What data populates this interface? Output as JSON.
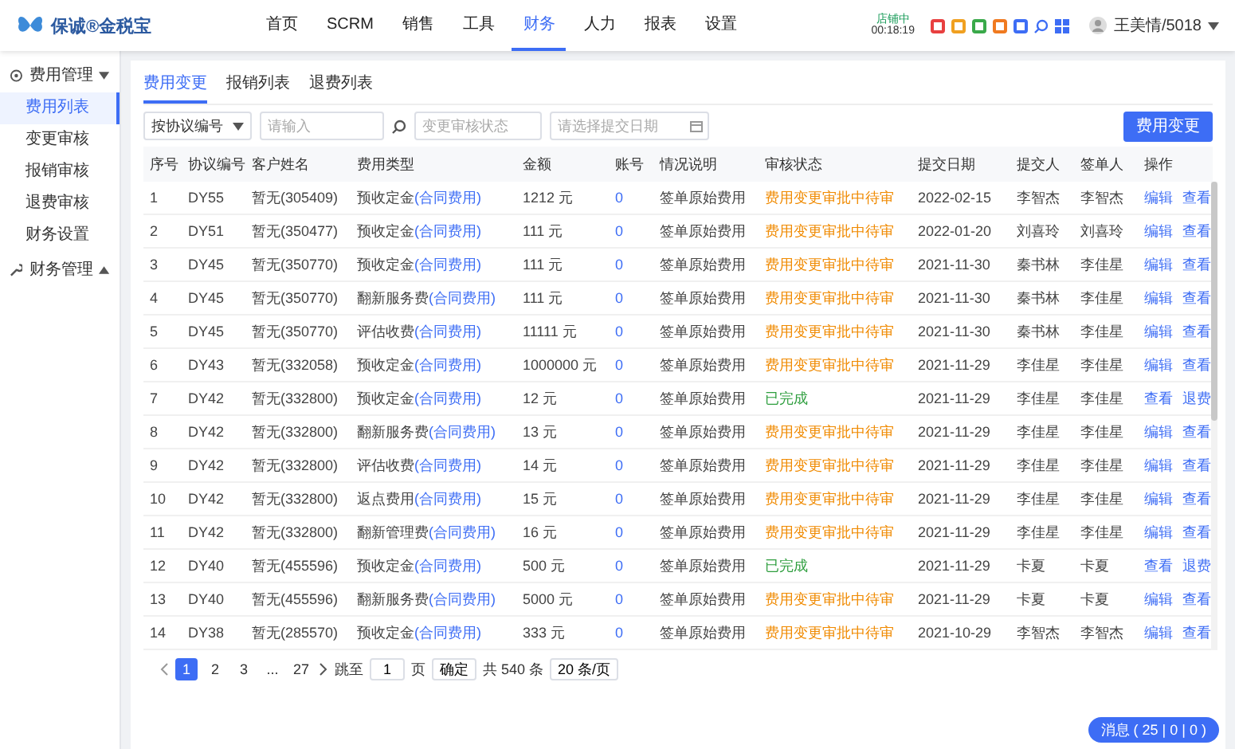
{
  "header": {
    "logo": "保诚®金税宝",
    "nav": [
      {
        "label": "首页",
        "selected": false
      },
      {
        "label": "SCRM",
        "selected": false
      },
      {
        "label": "销售",
        "selected": false
      },
      {
        "label": "工具",
        "selected": false
      },
      {
        "label": "财务",
        "selected": true
      },
      {
        "label": "人力",
        "selected": false
      },
      {
        "label": "报表",
        "selected": false
      },
      {
        "label": "设置",
        "selected": false
      }
    ],
    "status": "店铺中",
    "time": "00:18:19",
    "user": "王美情/5018"
  },
  "sidebar": [
    {
      "label": "费用管理",
      "expanded": true,
      "children": [
        {
          "label": "费用列表",
          "selected": true
        },
        {
          "label": "变更审核",
          "selected": false
        },
        {
          "label": "报销审核",
          "selected": false
        },
        {
          "label": "退费审核",
          "selected": false
        },
        {
          "label": "财务设置",
          "selected": false
        }
      ]
    },
    {
      "label": "财务管理",
      "expanded": false
    }
  ],
  "tabs": [
    {
      "label": "费用变更",
      "selected": true
    },
    {
      "label": "报销列表",
      "selected": false
    },
    {
      "label": "退费列表",
      "selected": false
    }
  ],
  "filters": {
    "search_by": "按协议编号",
    "search_placeholder": "请输入",
    "status_placeholder": "变更审核状态",
    "date_placeholder": "请选择提交日期"
  },
  "action_button": "费用变更",
  "table": {
    "columns": [
      "序号",
      "协议编号",
      "客户姓名",
      "费用类型",
      "金额",
      "账号",
      "情况说明",
      "审核状态",
      "提交日期",
      "提交人",
      "签单人",
      "操作"
    ],
    "rows": [
      {
        "no": "1",
        "code": "DY55",
        "customer": "暂无(305409)",
        "fee": "预收定金",
        "fee_link": "(合同费用)",
        "amount": "1212 元",
        "account": "0",
        "note": "签单原始费用",
        "status": "费用变更审批中待审",
        "kind": "pending",
        "date": "2022-02-15",
        "submitter": "李智杰",
        "signer": "李智杰",
        "actions": [
          "编辑",
          "查看"
        ]
      },
      {
        "no": "2",
        "code": "DY51",
        "customer": "暂无(350477)",
        "fee": "预收定金",
        "fee_link": "(合同费用)",
        "amount": "111 元",
        "account": "0",
        "note": "签单原始费用",
        "status": "费用变更审批中待审",
        "kind": "pending",
        "date": "2022-01-20",
        "submitter": "刘喜玲",
        "signer": "刘喜玲",
        "actions": [
          "编辑",
          "查看"
        ]
      },
      {
        "no": "3",
        "code": "DY45",
        "customer": "暂无(350770)",
        "fee": "预收定金",
        "fee_link": "(合同费用)",
        "amount": "111 元",
        "account": "0",
        "note": "签单原始费用",
        "status": "费用变更审批中待审",
        "kind": "pending",
        "date": "2021-11-30",
        "submitter": "秦书林",
        "signer": "李佳星",
        "actions": [
          "编辑",
          "查看"
        ]
      },
      {
        "no": "4",
        "code": "DY45",
        "customer": "暂无(350770)",
        "fee": "翻新服务费",
        "fee_link": "(合同费用)",
        "amount": "111 元",
        "account": "0",
        "note": "签单原始费用",
        "status": "费用变更审批中待审",
        "kind": "pending",
        "date": "2021-11-30",
        "submitter": "秦书林",
        "signer": "李佳星",
        "actions": [
          "编辑",
          "查看"
        ]
      },
      {
        "no": "5",
        "code": "DY45",
        "customer": "暂无(350770)",
        "fee": "评估收费",
        "fee_link": "(合同费用)",
        "amount": "11111 元",
        "account": "0",
        "note": "签单原始费用",
        "status": "费用变更审批中待审",
        "kind": "pending",
        "date": "2021-11-30",
        "submitter": "秦书林",
        "signer": "李佳星",
        "actions": [
          "编辑",
          "查看"
        ]
      },
      {
        "no": "6",
        "code": "DY43",
        "customer": "暂无(332058)",
        "fee": "预收定金",
        "fee_link": "(合同费用)",
        "amount": "1000000 元",
        "account": "0",
        "note": "签单原始费用",
        "status": "费用变更审批中待审",
        "kind": "pending",
        "date": "2021-11-29",
        "submitter": "李佳星",
        "signer": "李佳星",
        "actions": [
          "编辑",
          "查看"
        ]
      },
      {
        "no": "7",
        "code": "DY42",
        "customer": "暂无(332800)",
        "fee": "预收定金",
        "fee_link": "(合同费用)",
        "amount": "12 元",
        "account": "0",
        "note": "签单原始费用",
        "status": "已完成",
        "kind": "done",
        "date": "2021-11-29",
        "submitter": "李佳星",
        "signer": "李佳星",
        "actions": [
          "查看",
          "退费"
        ]
      },
      {
        "no": "8",
        "code": "DY42",
        "customer": "暂无(332800)",
        "fee": "翻新服务费",
        "fee_link": "(合同费用)",
        "amount": "13 元",
        "account": "0",
        "note": "签单原始费用",
        "status": "费用变更审批中待审",
        "kind": "pending",
        "date": "2021-11-29",
        "submitter": "李佳星",
        "signer": "李佳星",
        "actions": [
          "编辑",
          "查看"
        ]
      },
      {
        "no": "9",
        "code": "DY42",
        "customer": "暂无(332800)",
        "fee": "评估收费",
        "fee_link": "(合同费用)",
        "amount": "14 元",
        "account": "0",
        "note": "签单原始费用",
        "status": "费用变更审批中待审",
        "kind": "pending",
        "date": "2021-11-29",
        "submitter": "李佳星",
        "signer": "李佳星",
        "actions": [
          "编辑",
          "查看"
        ]
      },
      {
        "no": "10",
        "code": "DY42",
        "customer": "暂无(332800)",
        "fee": "返点费用",
        "fee_link": "(合同费用)",
        "amount": "15 元",
        "account": "0",
        "note": "签单原始费用",
        "status": "费用变更审批中待审",
        "kind": "pending",
        "date": "2021-11-29",
        "submitter": "李佳星",
        "signer": "李佳星",
        "actions": [
          "编辑",
          "查看"
        ]
      },
      {
        "no": "11",
        "code": "DY42",
        "customer": "暂无(332800)",
        "fee": "翻新管理费",
        "fee_link": "(合同费用)",
        "amount": "16 元",
        "account": "0",
        "note": "签单原始费用",
        "status": "费用变更审批中待审",
        "kind": "pending",
        "date": "2021-11-29",
        "submitter": "李佳星",
        "signer": "李佳星",
        "actions": [
          "编辑",
          "查看"
        ]
      },
      {
        "no": "12",
        "code": "DY40",
        "customer": "暂无(455596)",
        "fee": "预收定金",
        "fee_link": "(合同费用)",
        "amount": "500 元",
        "account": "0",
        "note": "签单原始费用",
        "status": "已完成",
        "kind": "done",
        "date": "2021-11-29",
        "submitter": "卡夏",
        "signer": "卡夏",
        "actions": [
          "查看",
          "退费"
        ]
      },
      {
        "no": "13",
        "code": "DY40",
        "customer": "暂无(455596)",
        "fee": "翻新服务费",
        "fee_link": "(合同费用)",
        "amount": "5000 元",
        "account": "0",
        "note": "签单原始费用",
        "status": "费用变更审批中待审",
        "kind": "pending",
        "date": "2021-11-29",
        "submitter": "卡夏",
        "signer": "卡夏",
        "actions": [
          "编辑",
          "查看"
        ]
      },
      {
        "no": "14",
        "code": "DY38",
        "customer": "暂无(285570)",
        "fee": "预收定金",
        "fee_link": "(合同费用)",
        "amount": "333 元",
        "account": "0",
        "note": "签单原始费用",
        "status": "费用变更审批中待审",
        "kind": "pending",
        "date": "2021-10-29",
        "submitter": "李智杰",
        "signer": "李智杰",
        "actions": [
          "编辑",
          "查看"
        ]
      }
    ]
  },
  "pagination": {
    "pages": [
      {
        "label": "1",
        "selected": true
      },
      {
        "label": "2",
        "selected": false
      },
      {
        "label": "3",
        "selected": false
      },
      {
        "label": "...",
        "selected": false
      },
      {
        "label": "27",
        "selected": false
      }
    ],
    "jump_label": "跳至",
    "jump_value": "1",
    "page_unit": "页",
    "confirm": "确定",
    "total": "共 540 条",
    "page_size": "20 条/页"
  },
  "message_badge": "消息 ( 25 | 0 | 0 )"
}
